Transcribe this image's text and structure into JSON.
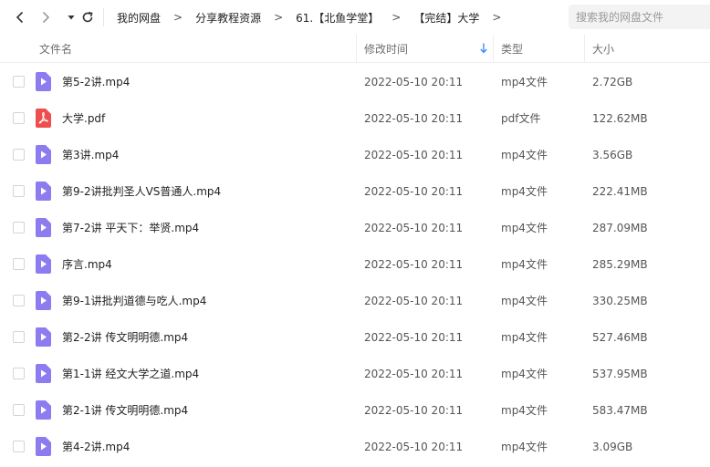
{
  "toolbar": {
    "back_icon": "chevron-left-icon",
    "forward_icon": "chevron-right-icon",
    "history_icon": "caret-down-icon",
    "refresh_icon": "refresh-icon"
  },
  "breadcrumb": [
    "我的网盘",
    "分享教程资源",
    "61.【北鱼学堂】",
    "【完结】大学"
  ],
  "breadcrumb_separator": ">",
  "search": {
    "placeholder": "搜索我的网盘文件"
  },
  "columns": {
    "name": "文件名",
    "modified": "修改时间",
    "type": "类型",
    "size": "大小"
  },
  "colors": {
    "video_icon": "#8c7cf0",
    "pdf_icon": "#ee4e4e",
    "sort_arrow": "#3b8cff"
  },
  "files": [
    {
      "name": "第5-2讲.mp4",
      "modified": "2022-05-10 20:11",
      "type": "mp4文件",
      "size": "2.72GB",
      "icon": "video-file-icon"
    },
    {
      "name": "大学.pdf",
      "modified": "2022-05-10 20:11",
      "type": "pdf文件",
      "size": "122.62MB",
      "icon": "pdf-file-icon"
    },
    {
      "name": "第3讲.mp4",
      "modified": "2022-05-10 20:11",
      "type": "mp4文件",
      "size": "3.56GB",
      "icon": "video-file-icon"
    },
    {
      "name": "第9-2讲批判圣人VS普通人.mp4",
      "modified": "2022-05-10 20:11",
      "type": "mp4文件",
      "size": "222.41MB",
      "icon": "video-file-icon"
    },
    {
      "name": "第7-2讲 平天下：举贤.mp4",
      "modified": "2022-05-10 20:11",
      "type": "mp4文件",
      "size": "287.09MB",
      "icon": "video-file-icon"
    },
    {
      "name": "序言.mp4",
      "modified": "2022-05-10 20:11",
      "type": "mp4文件",
      "size": "285.29MB",
      "icon": "video-file-icon"
    },
    {
      "name": "第9-1讲批判道德与吃人.mp4",
      "modified": "2022-05-10 20:11",
      "type": "mp4文件",
      "size": "330.25MB",
      "icon": "video-file-icon"
    },
    {
      "name": "第2-2讲 传文明明德.mp4",
      "modified": "2022-05-10 20:11",
      "type": "mp4文件",
      "size": "527.46MB",
      "icon": "video-file-icon"
    },
    {
      "name": "第1-1讲 经文大学之道.mp4",
      "modified": "2022-05-10 20:11",
      "type": "mp4文件",
      "size": "537.95MB",
      "icon": "video-file-icon"
    },
    {
      "name": "第2-1讲 传文明明德.mp4",
      "modified": "2022-05-10 20:11",
      "type": "mp4文件",
      "size": "583.47MB",
      "icon": "video-file-icon"
    },
    {
      "name": "第4-2讲.mp4",
      "modified": "2022-05-10 20:11",
      "type": "mp4文件",
      "size": "3.09GB",
      "icon": "video-file-icon"
    }
  ]
}
